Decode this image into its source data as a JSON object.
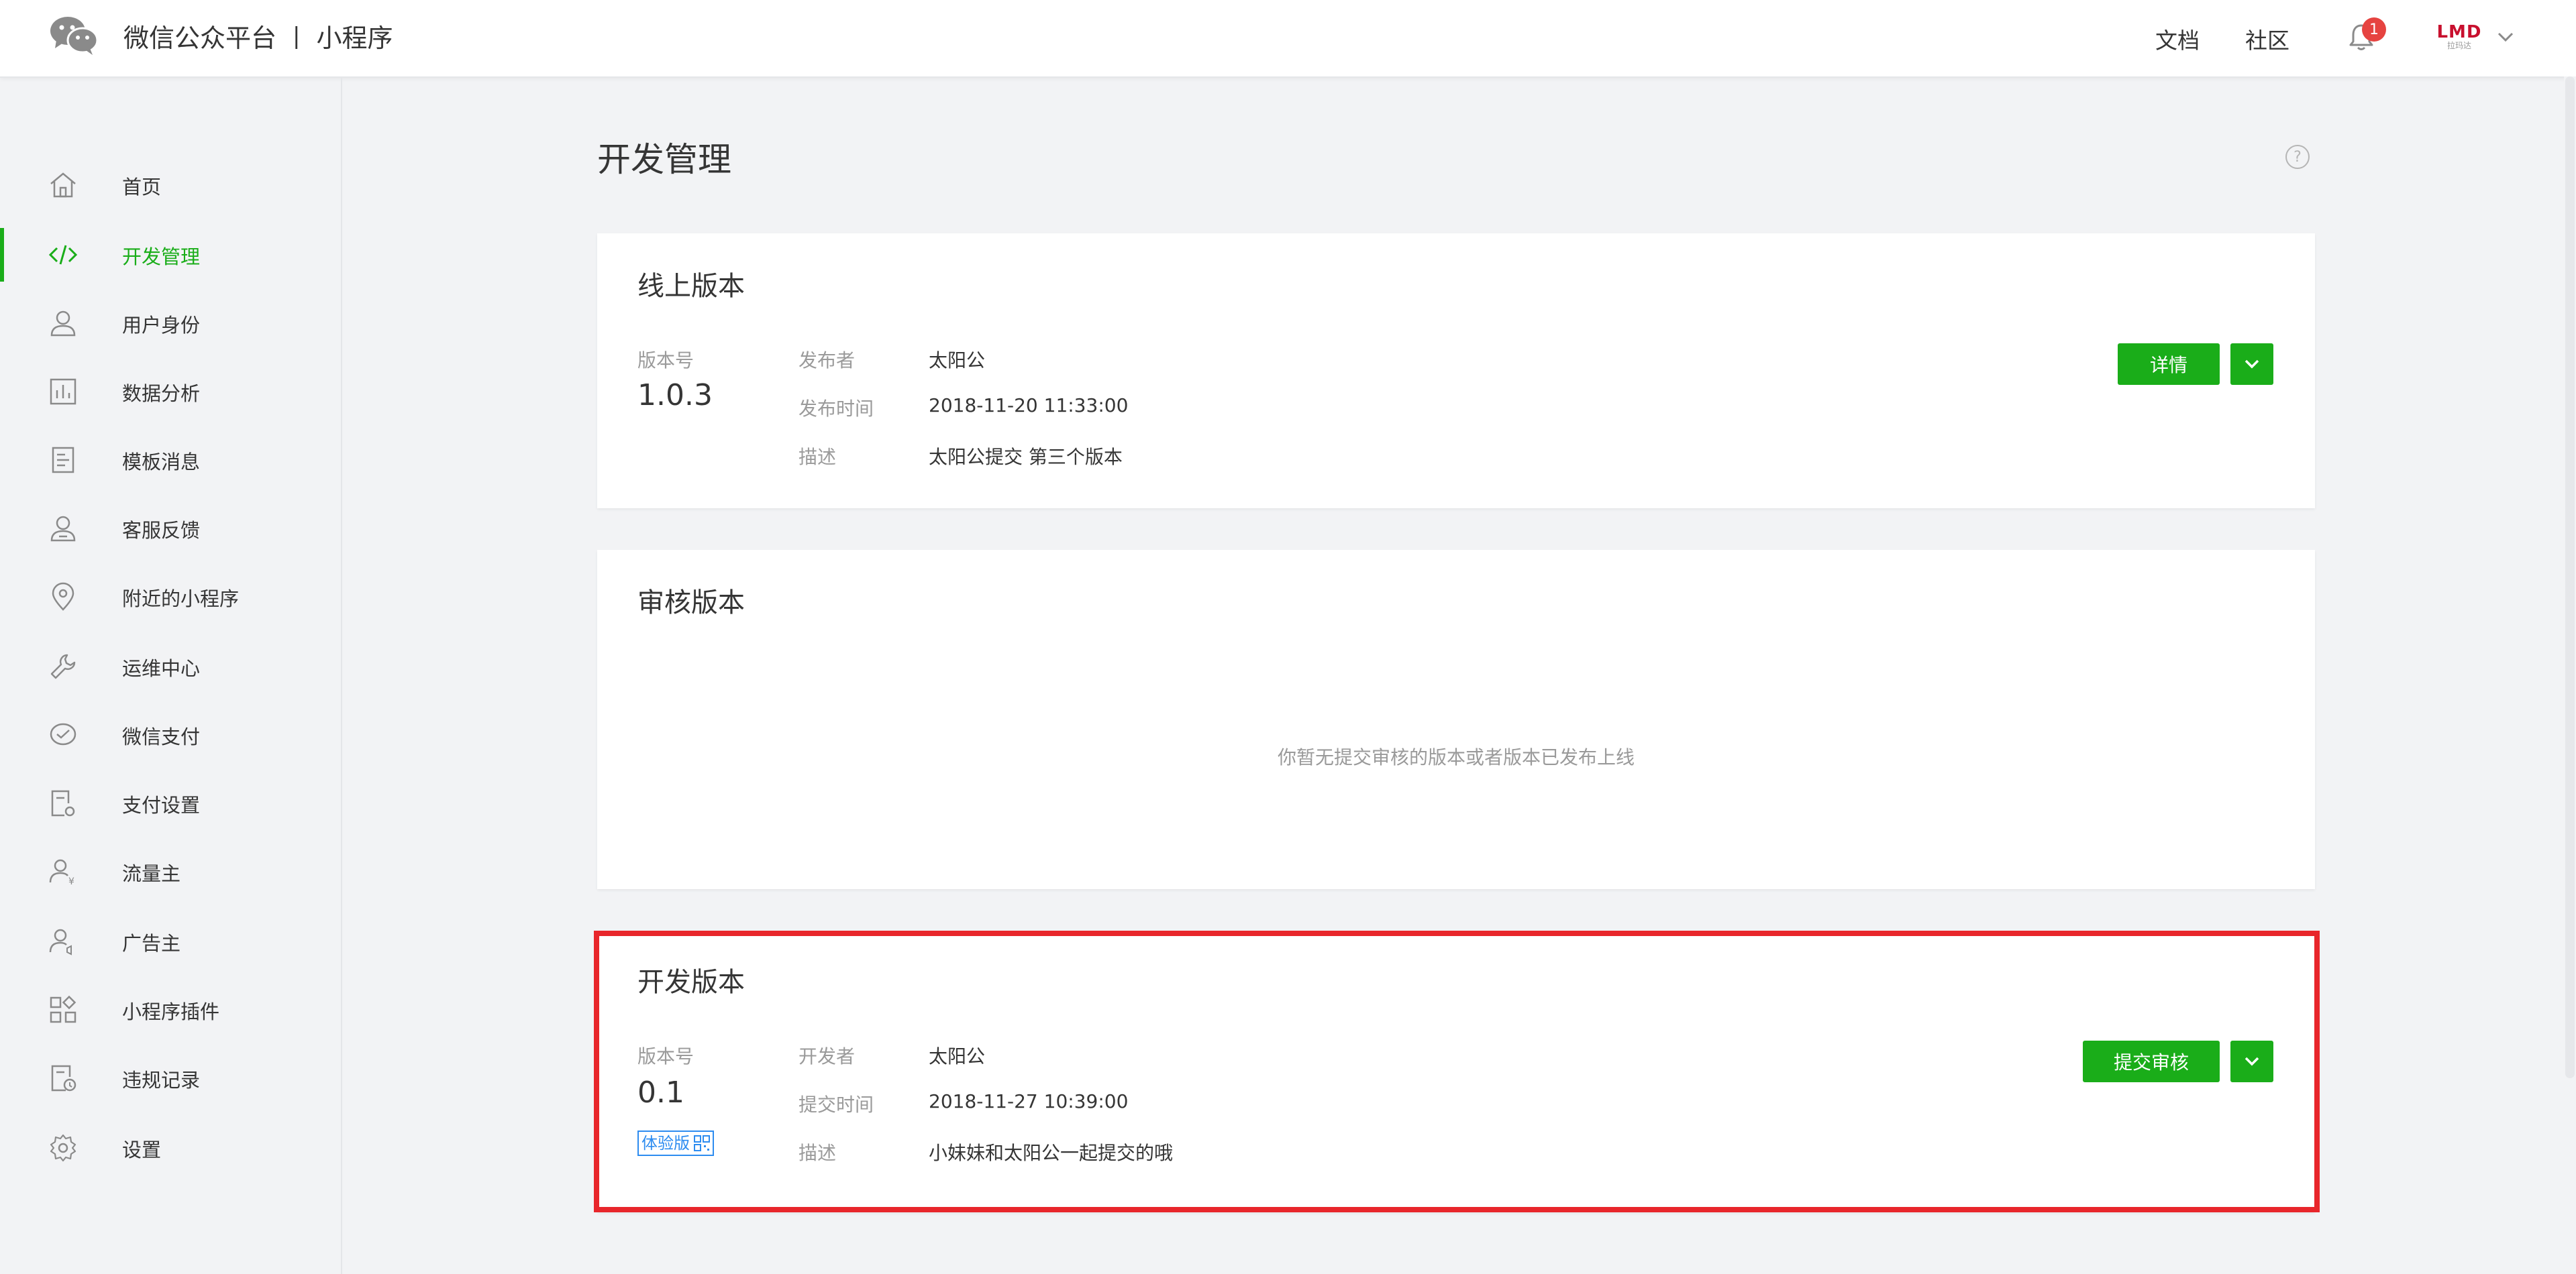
{
  "header": {
    "brand_title": "微信公众平台",
    "separator": "|",
    "brand_subtitle": "小程序",
    "links": {
      "docs": "文档",
      "community": "社区"
    },
    "notification_count": "1",
    "avatar": {
      "main": "LMD",
      "sub": "拉玛达"
    }
  },
  "sidebar": {
    "items": [
      {
        "label": "首页",
        "icon": "home-icon"
      },
      {
        "label": "开发管理",
        "icon": "code-icon",
        "active": true
      },
      {
        "label": "用户身份",
        "icon": "user-icon"
      },
      {
        "label": "数据分析",
        "icon": "chart-icon"
      },
      {
        "label": "模板消息",
        "icon": "document-icon"
      },
      {
        "label": "客服反馈",
        "icon": "customer-service-icon"
      },
      {
        "label": "附近的小程序",
        "icon": "location-icon"
      },
      {
        "label": "运维中心",
        "icon": "wrench-icon"
      },
      {
        "label": "微信支付",
        "icon": "wechat-pay-icon"
      },
      {
        "label": "支付设置",
        "icon": "payment-settings-icon"
      },
      {
        "label": "流量主",
        "icon": "traffic-owner-icon"
      },
      {
        "label": "广告主",
        "icon": "advertiser-icon"
      },
      {
        "label": "小程序插件",
        "icon": "plugin-icon"
      },
      {
        "label": "违规记录",
        "icon": "violation-record-icon"
      },
      {
        "label": "设置",
        "icon": "settings-icon"
      }
    ]
  },
  "main": {
    "title": "开发管理",
    "online": {
      "title": "线上版本",
      "version_label": "版本号",
      "version": "1.0.3",
      "publisher_label": "发布者",
      "publisher": "太阳公",
      "time_label": "发布时间",
      "time": "2018-11-20 11:33:00",
      "desc_label": "描述",
      "desc": "太阳公提交 第三个版本",
      "detail_button": "详情"
    },
    "review": {
      "title": "审核版本",
      "empty": "你暂无提交审核的版本或者版本已发布上线"
    },
    "dev": {
      "title": "开发版本",
      "version_label": "版本号",
      "version": "0.1",
      "trial_tag": "体验版",
      "developer_label": "开发者",
      "developer": "太阳公",
      "time_label": "提交时间",
      "time": "2018-11-27 10:39:00",
      "desc_label": "描述",
      "desc": "小妹妹和太阳公一起提交的哦",
      "submit_button": "提交审核"
    }
  },
  "colors": {
    "accent": "#1aad19",
    "highlight": "#e8262b",
    "badge": "#e64340",
    "tag": "#2d8cf0"
  }
}
